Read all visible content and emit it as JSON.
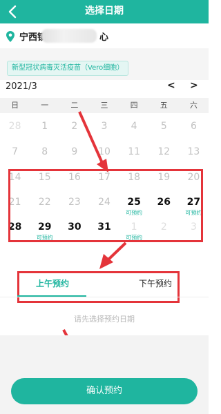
{
  "header": {
    "back_icon": "chevron-left-icon",
    "title": "选择日期"
  },
  "location": {
    "icon": "map-pin-icon",
    "name_prefix": "宁西镇",
    "name_suffix": "心"
  },
  "vaccine": {
    "chip_label": "新型冠状病毒灭活疫苗（Vero细胞）"
  },
  "calendar": {
    "month_label": "2021/3",
    "prev_label": "<",
    "next_label": ">",
    "weekdays": [
      "日",
      "一",
      "二",
      "三",
      "四",
      "五",
      "六"
    ],
    "weeks": [
      [
        {
          "num": "28",
          "state": "prev"
        },
        {
          "num": "1",
          "state": "off"
        },
        {
          "num": "2",
          "state": "off"
        },
        {
          "num": "3",
          "state": "off"
        },
        {
          "num": "4",
          "state": "off"
        },
        {
          "num": "5",
          "state": "off"
        },
        {
          "num": "6",
          "state": "off"
        }
      ],
      [
        {
          "num": "7",
          "state": "off"
        },
        {
          "num": "8",
          "state": "off"
        },
        {
          "num": "9",
          "state": "off"
        },
        {
          "num": "10",
          "state": "off"
        },
        {
          "num": "11",
          "state": "off"
        },
        {
          "num": "12",
          "state": "off"
        },
        {
          "num": "13",
          "state": "off"
        }
      ],
      [
        {
          "num": "14",
          "state": "off"
        },
        {
          "num": "15",
          "state": "off"
        },
        {
          "num": "16",
          "state": "off"
        },
        {
          "num": "17",
          "state": "off"
        },
        {
          "num": "18",
          "state": "off"
        },
        {
          "num": "19",
          "state": "off"
        },
        {
          "num": "20",
          "state": "off"
        }
      ],
      [
        {
          "num": "21",
          "state": "off"
        },
        {
          "num": "22",
          "state": "off"
        },
        {
          "num": "23",
          "state": "off"
        },
        {
          "num": "24",
          "state": "off"
        },
        {
          "num": "25",
          "state": "avail",
          "tag": "可预约"
        },
        {
          "num": "26",
          "state": "avail"
        },
        {
          "num": "27",
          "state": "avail",
          "tag": "可预约"
        }
      ],
      [
        {
          "num": "28",
          "state": "avail"
        },
        {
          "num": "29",
          "state": "avail",
          "tag": "可预约"
        },
        {
          "num": "30",
          "state": "avail"
        },
        {
          "num": "31",
          "state": "avail"
        },
        {
          "num": "1",
          "state": "next",
          "tag": "可预约"
        },
        {
          "num": "2",
          "state": "next"
        },
        {
          "num": "3",
          "state": "next"
        }
      ]
    ]
  },
  "tabs": {
    "am_label": "上午预约",
    "pm_label": "下午预约"
  },
  "hint": "请先选择预约日期",
  "confirm": {
    "label": "确认预约"
  },
  "colors": {
    "accent": "#1fb59f",
    "annotation_red": "#e4343a",
    "chip_bg": "#e4f6f3"
  }
}
